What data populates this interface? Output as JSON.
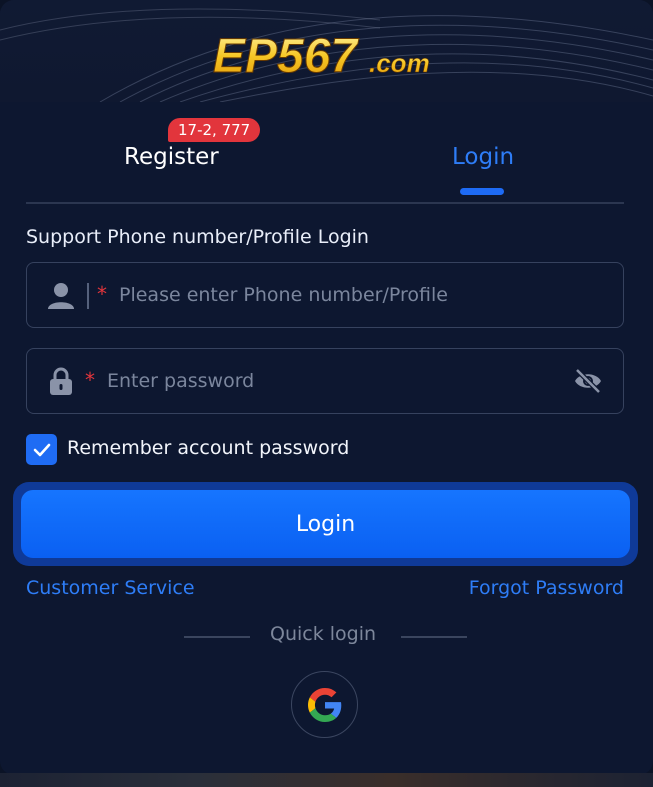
{
  "brand": {
    "logo_text_main": "EP567",
    "logo_text_suffix": ".com"
  },
  "tabs": [
    {
      "label": "Register",
      "badge": "17-2, 777",
      "active": false
    },
    {
      "label": "Login",
      "active": true
    }
  ],
  "form": {
    "section_label": "Support Phone number/Profile Login",
    "phone_placeholder": "Please enter Phone number/Profile",
    "password_placeholder": "Enter password",
    "required_mark": "*",
    "remember_label": "Remember account password",
    "remember_checked": true,
    "submit_label": "Login"
  },
  "links": {
    "customer_service": "Customer Service",
    "forgot_password": "Forgot Password"
  },
  "quick_login": {
    "label": "Quick login",
    "providers": [
      {
        "name": "google",
        "icon": "google-icon"
      }
    ]
  },
  "colors": {
    "accent": "#1e6bf5",
    "background": "#0d1730",
    "badge": "#e2353c"
  }
}
